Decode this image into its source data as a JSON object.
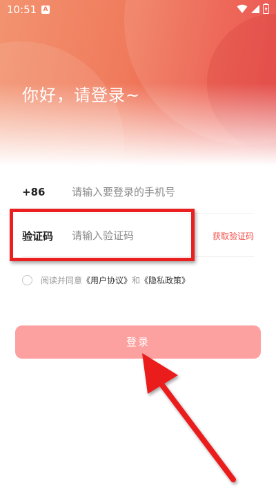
{
  "status_bar": {
    "time": "10:51",
    "notification_icon": "A"
  },
  "greeting": "你好，请登录~",
  "phone_row": {
    "prefix": "+86",
    "placeholder": "请输入要登录的手机号"
  },
  "code_row": {
    "label": "验证码",
    "placeholder": "请输入验证码",
    "get_code": "获取验证码"
  },
  "agreement": {
    "prefix": "阅读并同意",
    "user_agreement": "《用户协议》",
    "and": "和",
    "privacy_policy": "《隐私政策》"
  },
  "login_button": "登录",
  "colors": {
    "accent": "#ef4b45",
    "button_disabled": "#fca0a0",
    "highlight": "#ea1f1f"
  },
  "icons": [
    "wifi-icon",
    "signal-icon",
    "battery-icon"
  ]
}
